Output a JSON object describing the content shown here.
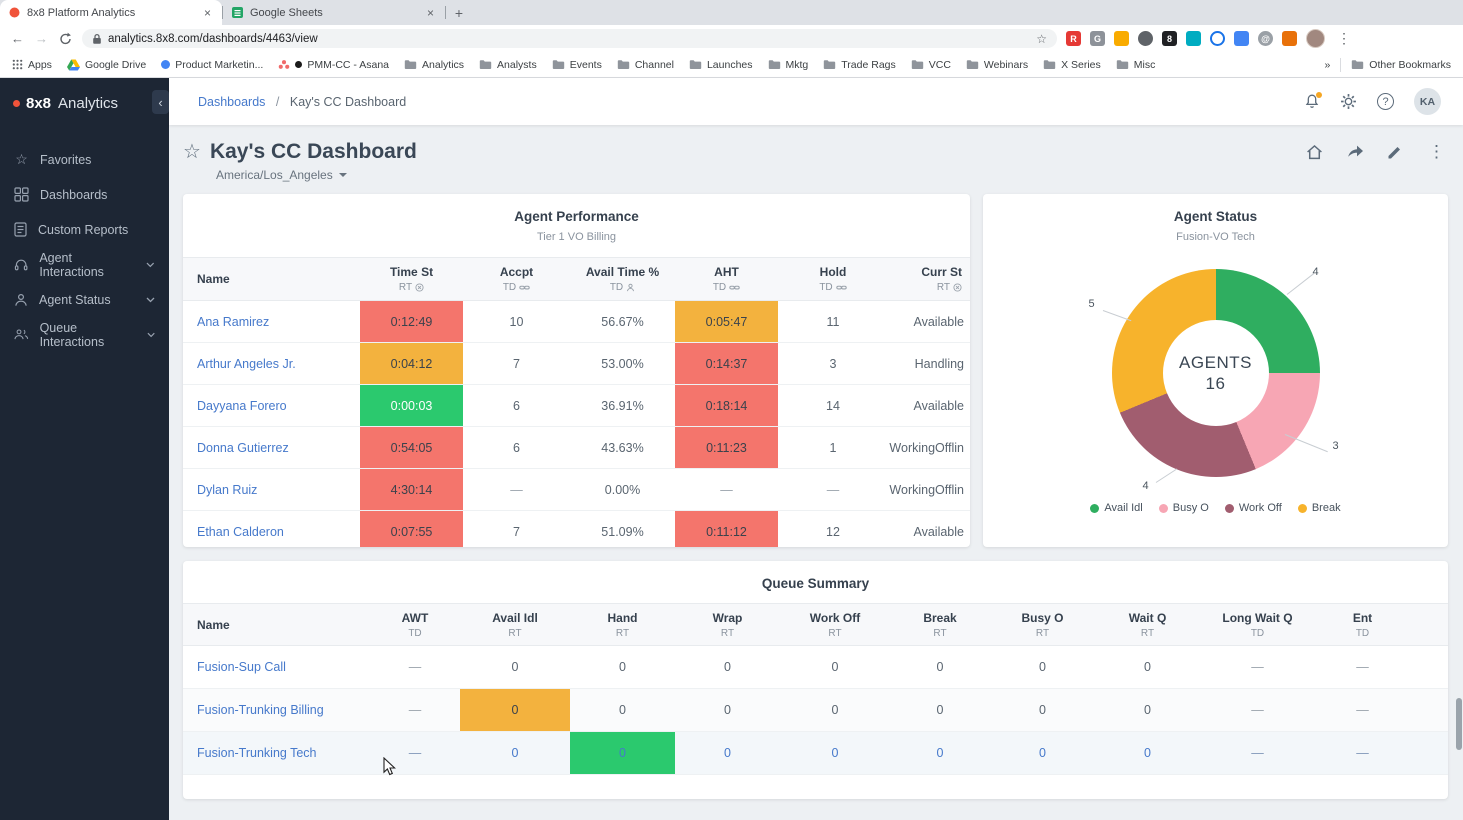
{
  "icons": {
    "close": "×",
    "new_tab": "+",
    "back": "←",
    "forward": "→",
    "kebab": "⋮",
    "star": "☆",
    "help": "?",
    "overflow": "»",
    "collapse": "‹",
    "breadcrumb_sep": "/"
  },
  "browser": {
    "tab1": "8x8 Platform Analytics",
    "tab2": "Google Sheets",
    "url": "analytics.8x8.com/dashboards/4463/view",
    "bookmarks": [
      "Apps",
      "Google Drive",
      "Product Marketin...",
      "PMM-CC - Asana",
      "Analytics",
      "Analysts",
      "Events",
      "Channel",
      "Launches",
      "Mktg",
      "Trade Rags",
      "VCC",
      "Webinars",
      "X Series",
      "Misc"
    ],
    "other_bookmarks": "Other Bookmarks"
  },
  "sidebar": {
    "brand_bold": "8x8",
    "brand_rest": "Analytics",
    "items": [
      "Favorites",
      "Dashboards",
      "Custom Reports",
      "Agent Interactions",
      "Agent Status",
      "Queue Interactions"
    ]
  },
  "topbar": {
    "breadcrumb_root": "Dashboards",
    "breadcrumb_current": "Kay's CC Dashboard",
    "avatar": "KA"
  },
  "page": {
    "title": "Kay's CC Dashboard",
    "timezone": "America/Los_Angeles"
  },
  "agent_performance": {
    "title": "Agent Performance",
    "subtitle": "Tier 1 VO Billing",
    "columns": [
      {
        "label": "Name",
        "sub": ""
      },
      {
        "label": "Time St",
        "sub": "RT"
      },
      {
        "label": "Accpt",
        "sub": "TD"
      },
      {
        "label": "Avail Time %",
        "sub": "TD"
      },
      {
        "label": "AHT",
        "sub": "TD"
      },
      {
        "label": "Hold",
        "sub": "TD"
      },
      {
        "label": "Curr St",
        "sub": "RT"
      }
    ],
    "rows": [
      {
        "name": "Ana Ramirez",
        "time_st": "0:12:49",
        "time_st_color": "red",
        "accpt": "10",
        "avail_time": "56.67%",
        "aht": "0:05:47",
        "aht_color": "orange",
        "hold": "11",
        "curr_st": "Available"
      },
      {
        "name": "Arthur Angeles Jr.",
        "time_st": "0:04:12",
        "time_st_color": "orange",
        "accpt": "7",
        "avail_time": "53.00%",
        "aht": "0:14:37",
        "aht_color": "red",
        "hold": "3",
        "curr_st": "Handling"
      },
      {
        "name": "Dayyana Forero",
        "time_st": "0:00:03",
        "time_st_color": "green",
        "accpt": "6",
        "avail_time": "36.91%",
        "aht": "0:18:14",
        "aht_color": "red",
        "hold": "14",
        "curr_st": "Available"
      },
      {
        "name": "Donna Gutierrez",
        "time_st": "0:54:05",
        "time_st_color": "red",
        "accpt": "6",
        "avail_time": "43.63%",
        "aht": "0:11:23",
        "aht_color": "red",
        "hold": "1",
        "curr_st": "WorkingOfflin"
      },
      {
        "name": "Dylan Ruiz",
        "time_st": "4:30:14",
        "time_st_color": "red",
        "accpt": "—",
        "avail_time": "0.00%",
        "aht": "—",
        "aht_color": "none",
        "hold": "—",
        "curr_st": "WorkingOfflin"
      },
      {
        "name": "Ethan Calderon",
        "time_st": "0:07:55",
        "time_st_color": "red",
        "accpt": "7",
        "avail_time": "51.09%",
        "aht": "0:11:12",
        "aht_color": "red",
        "hold": "12",
        "curr_st": "Available"
      }
    ]
  },
  "agent_status": {
    "title": "Agent Status",
    "subtitle": "Fusion-VO Tech",
    "center_label": "AGENTS",
    "center_value": "16",
    "legend": [
      {
        "label": "Avail Idl",
        "color": "#2fae60"
      },
      {
        "label": "Busy O",
        "color": "#f7a6b4"
      },
      {
        "label": "Work Off",
        "color": "#a15d6f"
      },
      {
        "label": "Break",
        "color": "#f7b32c"
      }
    ],
    "chart_data": {
      "type": "donut",
      "segments": [
        {
          "label": "Avail Idl",
          "value": 4,
          "color": "#2fae60"
        },
        {
          "label": "Busy O",
          "value": 3,
          "color": "#f7a6b4"
        },
        {
          "label": "Work Off",
          "value": 4,
          "color": "#a15d6f"
        },
        {
          "label": "Break",
          "value": 5,
          "color": "#f7b32c"
        }
      ],
      "total": 16
    }
  },
  "queue_summary": {
    "title": "Queue Summary",
    "columns": [
      {
        "label": "Name",
        "sub": ""
      },
      {
        "label": "AWT",
        "sub": "TD"
      },
      {
        "label": "Avail Idl",
        "sub": "RT"
      },
      {
        "label": "Hand",
        "sub": "RT"
      },
      {
        "label": "Wrap",
        "sub": "RT"
      },
      {
        "label": "Work Off",
        "sub": "RT"
      },
      {
        "label": "Break",
        "sub": "RT"
      },
      {
        "label": "Busy O",
        "sub": "RT"
      },
      {
        "label": "Wait Q",
        "sub": "RT"
      },
      {
        "label": "Long Wait Q",
        "sub": "TD"
      },
      {
        "label": "Ent",
        "sub": "TD"
      }
    ],
    "rows": [
      {
        "name": "Fusion-Sup Call",
        "values": [
          "—",
          "0",
          "0",
          "0",
          "0",
          "0",
          "0",
          "0",
          "—",
          "—"
        ]
      },
      {
        "name": "Fusion-Trunking Billing",
        "values": [
          "—",
          "0",
          "0",
          "0",
          "0",
          "0",
          "0",
          "0",
          "—",
          "—"
        ],
        "highlight": "Avail Idl:orange"
      },
      {
        "name": "Fusion-Trunking Tech",
        "values": [
          "—",
          "0",
          "0",
          "0",
          "0",
          "0",
          "0",
          "0",
          "—",
          "—"
        ],
        "highlight": "Hand:green",
        "state": "hover"
      }
    ]
  },
  "colors": {
    "highlight_red": "#f4756c",
    "highlight_orange": "#f3b23e",
    "highlight_green": "#2bc96e",
    "link_blue": "#4679cb",
    "sidebar_bg": "#1d2634"
  }
}
